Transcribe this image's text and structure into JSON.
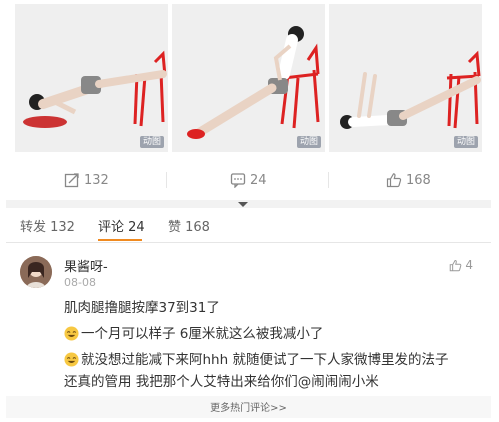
{
  "images": [
    {
      "badge": "动图"
    },
    {
      "badge": "动图"
    },
    {
      "badge": "动图"
    }
  ],
  "actions": {
    "share": {
      "icon": "share-icon",
      "count": "132"
    },
    "comment": {
      "icon": "comment-icon",
      "count": "24"
    },
    "like": {
      "icon": "thumb-up-icon",
      "count": "168"
    }
  },
  "tabs": {
    "reposts": "转发 132",
    "comments": "评论 24",
    "likes": "赞 168"
  },
  "comment": {
    "username": "果酱呀-",
    "time": "08-08",
    "like_count": "4",
    "lines": [
      "肌肉腿撸腿按摩37到31了",
      "一个月可以样子 6厘米就这么被我减小了",
      "就没想过能减下来阿hhh 就随便试了一下人家微博里发的法子",
      "还真的管用 我把那个人艾特出来给你们@闹闹闹小米"
    ]
  },
  "more_comments": "更多热门评论>>",
  "colors": {
    "accent": "#f08a20",
    "muted": "#888888",
    "divider": "#e6e6e6"
  }
}
